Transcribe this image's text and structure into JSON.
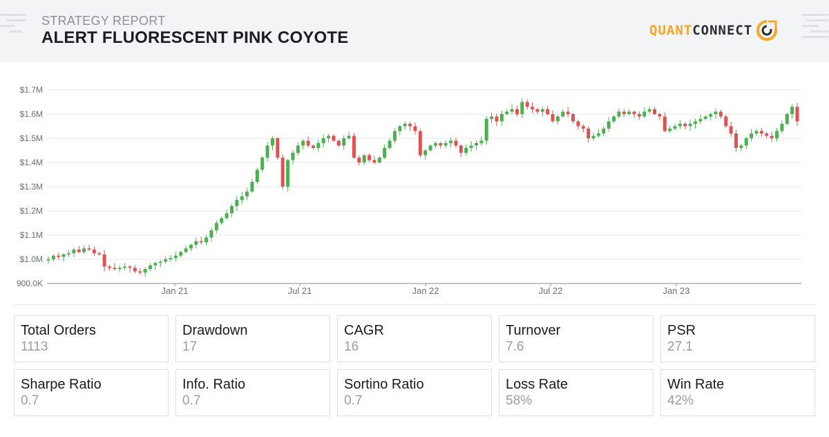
{
  "header": {
    "label": "STRATEGY REPORT",
    "title": "ALERT FLUORESCENT PINK COYOTE",
    "logo_primary": "QUANT",
    "logo_secondary": "CONNECT",
    "logo_icon": "quantconnect-logo-icon",
    "accent_color": "#f5a623"
  },
  "chart_data": {
    "type": "candlestick",
    "title": "",
    "xlabel": "",
    "ylabel": "",
    "ylim": [
      900000,
      1700000
    ],
    "y_ticks": [
      "$1.7M",
      "$1.6M",
      "$1.5M",
      "$1.4M",
      "$1.3M",
      "$1.2M",
      "$1.1M",
      "$1.0M",
      "900.0K"
    ],
    "x_ticks": [
      "Jan 21",
      "Jul 21",
      "Jan 22",
      "Jul 22",
      "Jan 23"
    ],
    "up_color": "#4caf50",
    "down_color": "#e05252",
    "grid": true,
    "closes": [
      1000000,
      1015000,
      1010000,
      1020000,
      1025000,
      1040000,
      1030000,
      1045000,
      1040000,
      1025000,
      1020000,
      970000,
      965000,
      960000,
      965000,
      970000,
      965000,
      950000,
      945000,
      960000,
      975000,
      985000,
      990000,
      1000000,
      1005000,
      1015000,
      1030000,
      1045000,
      1060000,
      1075000,
      1070000,
      1090000,
      1120000,
      1150000,
      1170000,
      1190000,
      1220000,
      1245000,
      1260000,
      1280000,
      1320000,
      1370000,
      1420000,
      1470000,
      1500000,
      1420000,
      1300000,
      1410000,
      1440000,
      1470000,
      1490000,
      1470000,
      1460000,
      1480000,
      1500000,
      1510000,
      1490000,
      1470000,
      1500000,
      1510000,
      1420000,
      1400000,
      1430000,
      1410000,
      1400000,
      1420000,
      1460000,
      1490000,
      1530000,
      1550000,
      1560000,
      1550000,
      1530000,
      1430000,
      1450000,
      1470000,
      1480000,
      1470000,
      1480000,
      1490000,
      1470000,
      1440000,
      1460000,
      1470000,
      1480000,
      1490000,
      1580000,
      1590000,
      1570000,
      1600000,
      1610000,
      1620000,
      1600000,
      1650000,
      1630000,
      1620000,
      1610000,
      1620000,
      1600000,
      1570000,
      1590000,
      1610000,
      1600000,
      1570000,
      1550000,
      1540000,
      1500000,
      1510000,
      1520000,
      1540000,
      1570000,
      1590000,
      1610000,
      1600000,
      1610000,
      1600000,
      1590000,
      1610000,
      1620000,
      1600000,
      1590000,
      1530000,
      1540000,
      1550000,
      1560000,
      1550000,
      1560000,
      1570000,
      1580000,
      1590000,
      1600000,
      1610000,
      1590000,
      1550000,
      1520000,
      1460000,
      1470000,
      1500000,
      1520000,
      1530000,
      1520000,
      1510000,
      1500000,
      1530000,
      1560000,
      1600000,
      1630000,
      1570000
    ]
  },
  "metrics": [
    {
      "label": "Total Orders",
      "value": "1113"
    },
    {
      "label": "Drawdown",
      "value": "17"
    },
    {
      "label": "CAGR",
      "value": "16"
    },
    {
      "label": "Turnover",
      "value": "7.6"
    },
    {
      "label": "PSR",
      "value": "27.1"
    },
    {
      "label": "Sharpe Ratio",
      "value": "0.7"
    },
    {
      "label": "Info. Ratio",
      "value": "0.7"
    },
    {
      "label": "Sortino Ratio",
      "value": "0.7"
    },
    {
      "label": "Loss Rate",
      "value": "58%"
    },
    {
      "label": "Win Rate",
      "value": "42%"
    }
  ]
}
